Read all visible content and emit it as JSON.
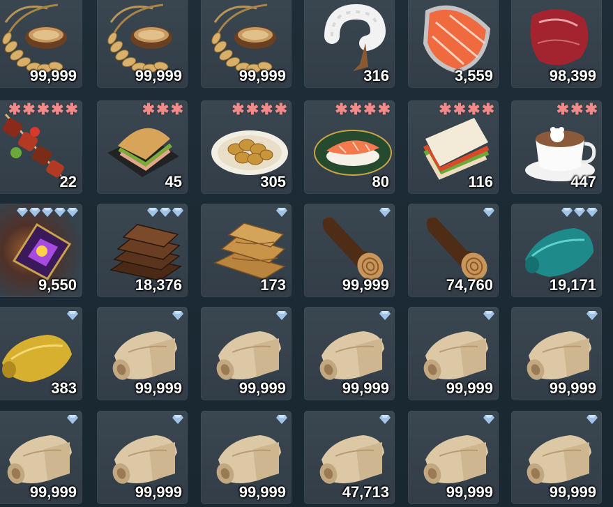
{
  "colors": {
    "star": "#f28a8a",
    "gem": "#9fc4e8",
    "slot_bg": "#36424c",
    "count_text": "#ffffff"
  },
  "inventory": [
    {
      "item": "rice-grain-icon",
      "count": "99,999",
      "rarity_type": "none",
      "rarity": 0
    },
    {
      "item": "rice-grain-icon",
      "count": "99,999",
      "rarity_type": "none",
      "rarity": 0
    },
    {
      "item": "rice-grain-icon",
      "count": "99,999",
      "rarity_type": "none",
      "rarity": 0
    },
    {
      "item": "shrimp-icon",
      "count": "316",
      "rarity_type": "none",
      "rarity": 0
    },
    {
      "item": "salmon-steak-icon",
      "count": "3,559",
      "rarity_type": "none",
      "rarity": 0
    },
    {
      "item": "raw-meat-icon",
      "count": "98,399",
      "rarity_type": "none",
      "rarity": 0
    },
    {
      "item": "meat-skewer-icon",
      "count": "22",
      "rarity_type": "star",
      "rarity": 5
    },
    {
      "item": "sandwich-icon",
      "count": "45",
      "rarity_type": "star",
      "rarity": 3
    },
    {
      "item": "fried-snack-plate-icon",
      "count": "305",
      "rarity_type": "star",
      "rarity": 4
    },
    {
      "item": "salmon-sushi-icon",
      "count": "80",
      "rarity_type": "star",
      "rarity": 4
    },
    {
      "item": "club-sandwich-icon",
      "count": "116",
      "rarity_type": "star",
      "rarity": 4
    },
    {
      "item": "latte-cup-icon",
      "count": "447",
      "rarity_type": "star",
      "rarity": 3
    },
    {
      "item": "purple-crystal-icon",
      "count": "9,550",
      "rarity_type": "gem",
      "rarity": 5
    },
    {
      "item": "dark-planks-icon",
      "count": "18,376",
      "rarity_type": "gem",
      "rarity": 3
    },
    {
      "item": "light-planks-icon",
      "count": "173",
      "rarity_type": "gem",
      "rarity": 1
    },
    {
      "item": "log-icon",
      "count": "99,999",
      "rarity_type": "gem",
      "rarity": 1
    },
    {
      "item": "log-icon",
      "count": "74,760",
      "rarity_type": "gem",
      "rarity": 1
    },
    {
      "item": "teal-fabric-icon",
      "count": "19,171",
      "rarity_type": "gem",
      "rarity": 3
    },
    {
      "item": "gold-fabric-icon",
      "count": "383",
      "rarity_type": "gem",
      "rarity": 1
    },
    {
      "item": "paper-scroll-icon",
      "count": "99,999",
      "rarity_type": "gem",
      "rarity": 1
    },
    {
      "item": "paper-scroll-icon",
      "count": "99,999",
      "rarity_type": "gem",
      "rarity": 1
    },
    {
      "item": "paper-scroll-icon",
      "count": "99,999",
      "rarity_type": "gem",
      "rarity": 1
    },
    {
      "item": "paper-scroll-icon",
      "count": "99,999",
      "rarity_type": "gem",
      "rarity": 1
    },
    {
      "item": "paper-scroll-icon",
      "count": "99,999",
      "rarity_type": "gem",
      "rarity": 1
    },
    {
      "item": "paper-scroll-icon",
      "count": "99,999",
      "rarity_type": "gem",
      "rarity": 1
    },
    {
      "item": "paper-scroll-icon",
      "count": "99,999",
      "rarity_type": "gem",
      "rarity": 1
    },
    {
      "item": "paper-scroll-icon",
      "count": "99,999",
      "rarity_type": "gem",
      "rarity": 1
    },
    {
      "item": "paper-scroll-icon",
      "count": "47,713",
      "rarity_type": "gem",
      "rarity": 1
    },
    {
      "item": "paper-scroll-icon",
      "count": "99,999",
      "rarity_type": "gem",
      "rarity": 1
    },
    {
      "item": "paper-scroll-icon",
      "count": "99,999",
      "rarity_type": "gem",
      "rarity": 1
    }
  ]
}
